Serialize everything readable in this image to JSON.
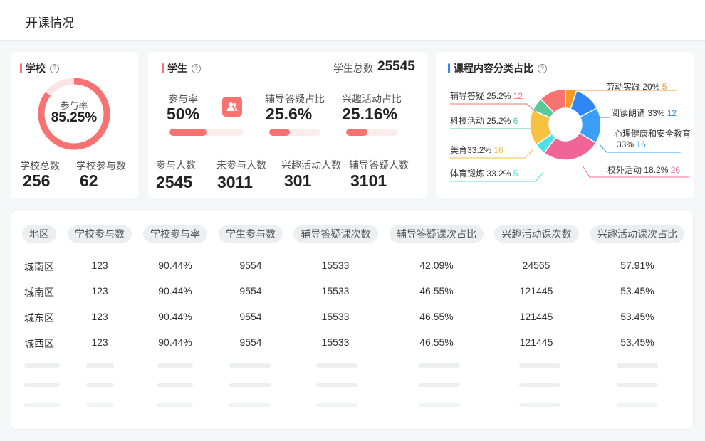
{
  "page": {
    "title": "开课情况"
  },
  "school": {
    "title": "学校",
    "gauge_label": "参与率",
    "gauge_value": "85.25%",
    "gauge_fraction": 0.8525,
    "total_label": "学校总数",
    "total_value": "256",
    "participating_label": "学校参与数",
    "participating_value": "62"
  },
  "student": {
    "title": "学生",
    "total_label": "学生总数",
    "total_value": "25545",
    "metrics": [
      {
        "label": "参与率",
        "value": "50%",
        "fraction": 0.5
      },
      {
        "label": "辅导答疑占比",
        "value": "25.6%",
        "fraction": 0.4
      },
      {
        "label": "兴趣活动占比",
        "value": "25.16%",
        "fraction": 0.42
      }
    ],
    "counts": [
      {
        "label": "参与人数",
        "value": "2545"
      },
      {
        "label": "未参与人数",
        "value": "3011"
      },
      {
        "label": "兴趣活动人数",
        "value": "301"
      },
      {
        "label": "辅导答疑人数",
        "value": "3101"
      }
    ]
  },
  "course": {
    "title": "课程内容分类占比",
    "legend": [
      {
        "name": "辅导答疑",
        "pct": "25.2%",
        "count": "12",
        "color": "#f87272"
      },
      {
        "name": "科技活动",
        "pct": "25.2%",
        "count": "6",
        "color": "#5cc99a"
      },
      {
        "name": "美育",
        "pct": "33.2%",
        "count": "16",
        "color": "#f5c242"
      },
      {
        "name": "体育锻炼",
        "pct": "33.2%",
        "count": "5",
        "color": "#4fe0e6"
      },
      {
        "name": "劳动实践",
        "pct": "20%",
        "count": "5",
        "color": "#f59a23"
      },
      {
        "name": "阅读朗诵",
        "pct": "33%",
        "count": "12",
        "color": "#2f86f6"
      },
      {
        "name": "心理健康和安全教育",
        "pct": "33%",
        "count": "16",
        "color": "#3ba0f5"
      },
      {
        "name": "校外活动",
        "pct": "18.2%",
        "count": "26",
        "color": "#f06595"
      }
    ]
  },
  "chart_data": {
    "type": "pie",
    "categories": [
      "劳动实践",
      "阅读朗诵",
      "心理健康和安全教育",
      "校外活动",
      "体育锻炼",
      "美育",
      "科技活动",
      "辅导答疑"
    ],
    "values": [
      5,
      12,
      16,
      26,
      5,
      16,
      6,
      12
    ],
    "colors": [
      "#f59a23",
      "#2f86f6",
      "#3ba0f5",
      "#f06595",
      "#4fe0e6",
      "#f5c242",
      "#5cc99a",
      "#f87272"
    ]
  },
  "table": {
    "headers": [
      "地区",
      "学校参与数",
      "学校参与率",
      "学生参与数",
      "辅导答疑课次数",
      "辅导答疑课次占比",
      "兴趣活动课次数",
      "兴趣活动课次占比"
    ],
    "rows": [
      [
        "城南区",
        "123",
        "90.44%",
        "9554",
        "15533",
        "42.09%",
        "24565",
        "57.91%"
      ],
      [
        "城南区",
        "123",
        "90.44%",
        "9554",
        "15533",
        "46.55%",
        "121445",
        "53.45%"
      ],
      [
        "城东区",
        "123",
        "90.44%",
        "9554",
        "15533",
        "46.55%",
        "121445",
        "53.45%"
      ],
      [
        "城西区",
        "123",
        "90.44%",
        "9554",
        "15533",
        "46.55%",
        "121445",
        "53.45%"
      ]
    ]
  }
}
